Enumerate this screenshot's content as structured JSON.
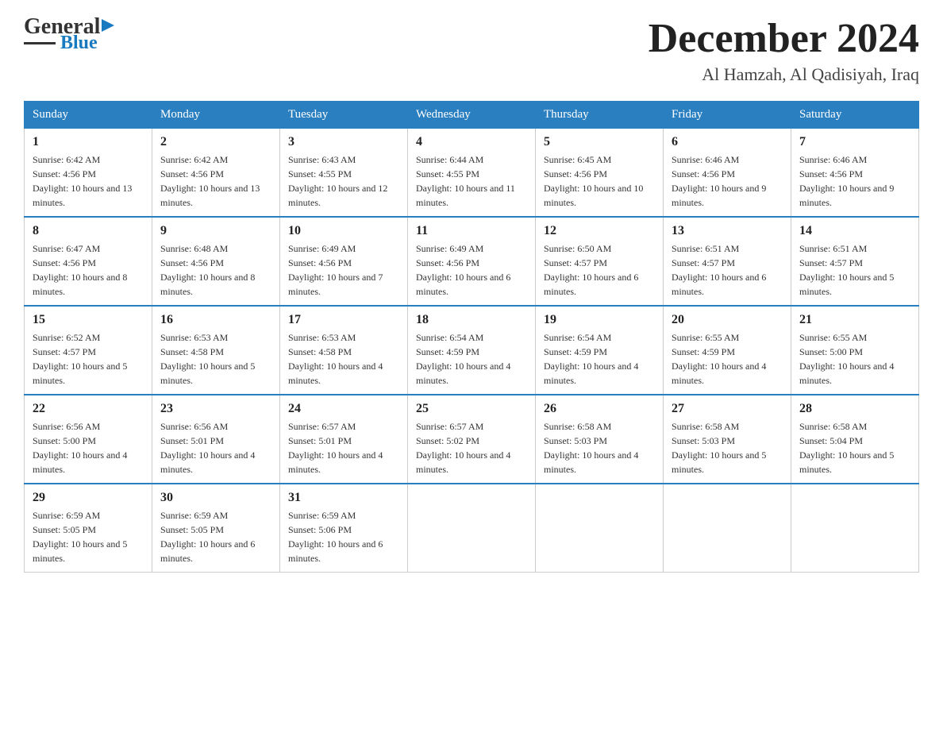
{
  "header": {
    "logo_general": "General",
    "logo_blue": "Blue",
    "month_title": "December 2024",
    "subtitle": "Al Hamzah, Al Qadisiyah, Iraq"
  },
  "weekdays": [
    "Sunday",
    "Monday",
    "Tuesday",
    "Wednesday",
    "Thursday",
    "Friday",
    "Saturday"
  ],
  "weeks": [
    [
      {
        "day": "1",
        "sunrise": "6:42 AM",
        "sunset": "4:56 PM",
        "daylight": "10 hours and 13 minutes."
      },
      {
        "day": "2",
        "sunrise": "6:42 AM",
        "sunset": "4:56 PM",
        "daylight": "10 hours and 13 minutes."
      },
      {
        "day": "3",
        "sunrise": "6:43 AM",
        "sunset": "4:55 PM",
        "daylight": "10 hours and 12 minutes."
      },
      {
        "day": "4",
        "sunrise": "6:44 AM",
        "sunset": "4:55 PM",
        "daylight": "10 hours and 11 minutes."
      },
      {
        "day": "5",
        "sunrise": "6:45 AM",
        "sunset": "4:56 PM",
        "daylight": "10 hours and 10 minutes."
      },
      {
        "day": "6",
        "sunrise": "6:46 AM",
        "sunset": "4:56 PM",
        "daylight": "10 hours and 9 minutes."
      },
      {
        "day": "7",
        "sunrise": "6:46 AM",
        "sunset": "4:56 PM",
        "daylight": "10 hours and 9 minutes."
      }
    ],
    [
      {
        "day": "8",
        "sunrise": "6:47 AM",
        "sunset": "4:56 PM",
        "daylight": "10 hours and 8 minutes."
      },
      {
        "day": "9",
        "sunrise": "6:48 AM",
        "sunset": "4:56 PM",
        "daylight": "10 hours and 8 minutes."
      },
      {
        "day": "10",
        "sunrise": "6:49 AM",
        "sunset": "4:56 PM",
        "daylight": "10 hours and 7 minutes."
      },
      {
        "day": "11",
        "sunrise": "6:49 AM",
        "sunset": "4:56 PM",
        "daylight": "10 hours and 6 minutes."
      },
      {
        "day": "12",
        "sunrise": "6:50 AM",
        "sunset": "4:57 PM",
        "daylight": "10 hours and 6 minutes."
      },
      {
        "day": "13",
        "sunrise": "6:51 AM",
        "sunset": "4:57 PM",
        "daylight": "10 hours and 6 minutes."
      },
      {
        "day": "14",
        "sunrise": "6:51 AM",
        "sunset": "4:57 PM",
        "daylight": "10 hours and 5 minutes."
      }
    ],
    [
      {
        "day": "15",
        "sunrise": "6:52 AM",
        "sunset": "4:57 PM",
        "daylight": "10 hours and 5 minutes."
      },
      {
        "day": "16",
        "sunrise": "6:53 AM",
        "sunset": "4:58 PM",
        "daylight": "10 hours and 5 minutes."
      },
      {
        "day": "17",
        "sunrise": "6:53 AM",
        "sunset": "4:58 PM",
        "daylight": "10 hours and 4 minutes."
      },
      {
        "day": "18",
        "sunrise": "6:54 AM",
        "sunset": "4:59 PM",
        "daylight": "10 hours and 4 minutes."
      },
      {
        "day": "19",
        "sunrise": "6:54 AM",
        "sunset": "4:59 PM",
        "daylight": "10 hours and 4 minutes."
      },
      {
        "day": "20",
        "sunrise": "6:55 AM",
        "sunset": "4:59 PM",
        "daylight": "10 hours and 4 minutes."
      },
      {
        "day": "21",
        "sunrise": "6:55 AM",
        "sunset": "5:00 PM",
        "daylight": "10 hours and 4 minutes."
      }
    ],
    [
      {
        "day": "22",
        "sunrise": "6:56 AM",
        "sunset": "5:00 PM",
        "daylight": "10 hours and 4 minutes."
      },
      {
        "day": "23",
        "sunrise": "6:56 AM",
        "sunset": "5:01 PM",
        "daylight": "10 hours and 4 minutes."
      },
      {
        "day": "24",
        "sunrise": "6:57 AM",
        "sunset": "5:01 PM",
        "daylight": "10 hours and 4 minutes."
      },
      {
        "day": "25",
        "sunrise": "6:57 AM",
        "sunset": "5:02 PM",
        "daylight": "10 hours and 4 minutes."
      },
      {
        "day": "26",
        "sunrise": "6:58 AM",
        "sunset": "5:03 PM",
        "daylight": "10 hours and 4 minutes."
      },
      {
        "day": "27",
        "sunrise": "6:58 AM",
        "sunset": "5:03 PM",
        "daylight": "10 hours and 5 minutes."
      },
      {
        "day": "28",
        "sunrise": "6:58 AM",
        "sunset": "5:04 PM",
        "daylight": "10 hours and 5 minutes."
      }
    ],
    [
      {
        "day": "29",
        "sunrise": "6:59 AM",
        "sunset": "5:05 PM",
        "daylight": "10 hours and 5 minutes."
      },
      {
        "day": "30",
        "sunrise": "6:59 AM",
        "sunset": "5:05 PM",
        "daylight": "10 hours and 6 minutes."
      },
      {
        "day": "31",
        "sunrise": "6:59 AM",
        "sunset": "5:06 PM",
        "daylight": "10 hours and 6 minutes."
      },
      null,
      null,
      null,
      null
    ]
  ]
}
